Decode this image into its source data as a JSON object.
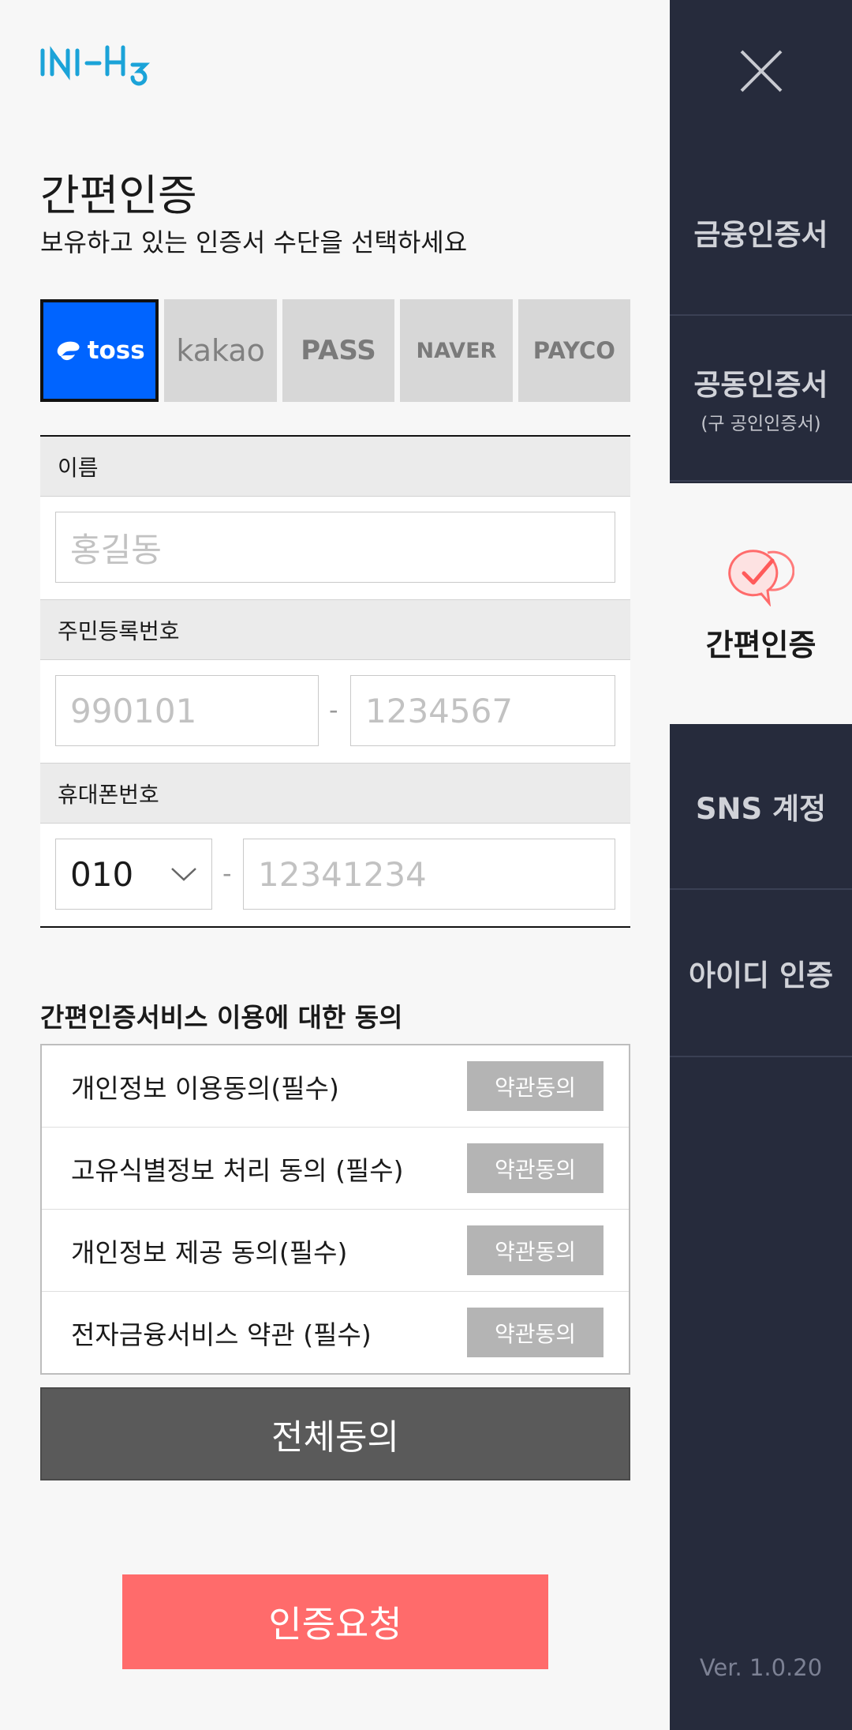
{
  "logo": {
    "text": "INI-HB"
  },
  "title": "간편인증",
  "subtitle": "보유하고 있는 인증서 수단을 선택하세요",
  "providers": [
    {
      "label": "toss",
      "selected": true
    },
    {
      "label": "kakao",
      "selected": false
    },
    {
      "label": "PASS",
      "selected": false
    },
    {
      "label": "NAVER",
      "selected": false
    },
    {
      "label": "PAYCO",
      "selected": false
    }
  ],
  "form": {
    "name_label": "이름",
    "name_placeholder": "홍길동",
    "rrn_label": "주민등록번호",
    "rrn_front_placeholder": "990101",
    "rrn_back_placeholder": "1234567",
    "dash": "-",
    "phone_label": "휴대폰번호",
    "phone_prefix": "010",
    "phone_placeholder": "12341234"
  },
  "consent": {
    "title": "간편인증서비스 이용에 대한 동의",
    "items": [
      {
        "label": "개인정보 이용동의(필수)",
        "button": "약관동의"
      },
      {
        "label": "고유식별정보 처리 동의 (필수)",
        "button": "약관동의"
      },
      {
        "label": "개인정보 제공 동의(필수)",
        "button": "약관동의"
      },
      {
        "label": "전자금융서비스 약관 (필수)",
        "button": "약관동의"
      }
    ],
    "agree_all": "전체동의"
  },
  "request_button": "인증요청",
  "sidebar": {
    "items": [
      {
        "label": "금융인증서",
        "sub": ""
      },
      {
        "label": "공동인증서",
        "sub": "(구 공인인증서)"
      },
      {
        "label": "간편인증",
        "sub": "",
        "active": true
      },
      {
        "label": "SNS 계정",
        "sub": ""
      },
      {
        "label": "아이디 인증",
        "sub": ""
      }
    ],
    "version": "Ver. 1.0.20"
  },
  "colors": {
    "accent": "#ff6b6b",
    "toss": "#0064ff",
    "sidebar_bg": "#262b3c",
    "logo": "#1ba3d8"
  }
}
